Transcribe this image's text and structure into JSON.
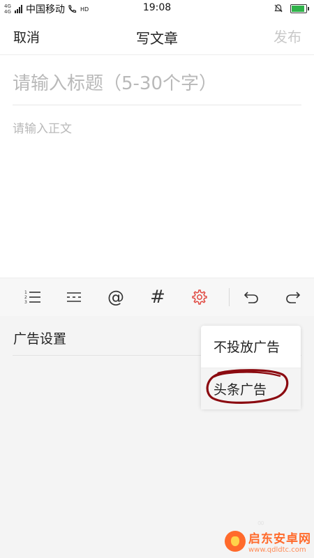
{
  "status_bar": {
    "network_small": "4G 4G",
    "carrier": "中国移动",
    "hd": "HD",
    "time": "19:08"
  },
  "nav": {
    "cancel": "取消",
    "title": "写文章",
    "publish": "发布"
  },
  "editor": {
    "title_placeholder": "请输入标题（5-30个字）",
    "body_placeholder": "请输入正文"
  },
  "toolbar": {
    "items": [
      "ordered-list-icon",
      "divider-line-icon",
      "at-mention-icon",
      "hashtag-icon",
      "settings-gear-icon",
      "undo-icon",
      "redo-icon"
    ],
    "hashtag": "#",
    "at": "@",
    "active_color": "#e0473f"
  },
  "ad_settings": {
    "label": "广告设置",
    "options": [
      "不投放广告",
      "头条广告"
    ],
    "selected": "头条广告"
  },
  "watermark": {
    "title": "启东安卓网",
    "url": "www.qdldtc.com"
  },
  "colors": {
    "publish_disabled": "#c8c8c8",
    "circle_mark": "#8b0a10",
    "battery": "#2fb34a"
  }
}
